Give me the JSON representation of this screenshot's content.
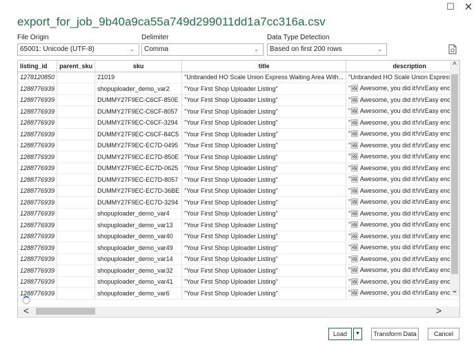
{
  "window": {
    "maximize_glyph": "☐",
    "close_glyph": "✕",
    "title": "export_for_job_9b40a9ca55a749d299011dd1a7cc316a.csv"
  },
  "settings": {
    "file_origin_label": "File Origin",
    "file_origin_value": "65001: Unicode (UTF-8)",
    "delimiter_label": "Delimiter",
    "delimiter_value": "Comma",
    "detection_label": "Data Type Detection",
    "detection_value": "Based on first 200 rows",
    "chevron": "⌄"
  },
  "table": {
    "columns": [
      "listing_id",
      "parent_sku",
      "sku",
      "title",
      "description"
    ],
    "rows": [
      [
        "1278120850",
        "",
        "21019",
        "\"Unbranded HO Scale Union Express Waiting Area With...",
        "\"Unbranded HO Scale Union Express Waitin"
      ],
      [
        "1288776939",
        "",
        "shopuploader_demo_var2",
        "\"Your First Shop Uploader Listing\"",
        "\"🖼 Awesome, you did it!\\r\\rEasy enough,"
      ],
      [
        "1288776939",
        "",
        "DUMMY27F9EC-C6CF-850E",
        "\"Your First Shop Uploader Listing\"",
        "\"🖼 Awesome, you did it!\\r\\rEasy enough,"
      ],
      [
        "1288776939",
        "",
        "DUMMY27F9EC-C6CF-8057",
        "\"Your First Shop Uploader Listing\"",
        "\"🖼 Awesome, you did it!\\r\\rEasy enough,"
      ],
      [
        "1288776939",
        "",
        "DUMMY27F9EC-C6CF-3294",
        "\"Your First Shop Uploader Listing\"",
        "\"🖼 Awesome, you did it!\\r\\rEasy enough,"
      ],
      [
        "1288776939",
        "",
        "DUMMY27F9EC-C6CF-84C5",
        "\"Your First Shop Uploader Listing\"",
        "\"🖼 Awesome, you did it!\\r\\rEasy enough,"
      ],
      [
        "1288776939",
        "",
        "DUMMY27F9EC-EC7D-0495",
        "\"Your First Shop Uploader Listing\"",
        "\"🖼 Awesome, you did it!\\r\\rEasy enough,"
      ],
      [
        "1288776939",
        "",
        "DUMMY27F9EC-EC7D-850E",
        "\"Your First Shop Uploader Listing\"",
        "\"🖼 Awesome, you did it!\\r\\rEasy enough,"
      ],
      [
        "1288776939",
        "",
        "DUMMY27F9EC-EC7D-0625",
        "\"Your First Shop Uploader Listing\"",
        "\"🖼 Awesome, you did it!\\r\\rEasy enough,"
      ],
      [
        "1288776939",
        "",
        "DUMMY27F9EC-EC7D-8057",
        "\"Your First Shop Uploader Listing\"",
        "\"🖼 Awesome, you did it!\\r\\rEasy enough,"
      ],
      [
        "1288776939",
        "",
        "DUMMY27F9EC-EC7D-36BE",
        "\"Your First Shop Uploader Listing\"",
        "\"🖼 Awesome, you did it!\\r\\rEasy enough,"
      ],
      [
        "1288776939",
        "",
        "DUMMY27F9EC-EC7D-3294",
        "\"Your First Shop Uploader Listing\"",
        "\"🖼 Awesome, you did it!\\r\\rEasy enough,"
      ],
      [
        "1288776939",
        "",
        "shopuploader_demo_var4",
        "\"Your First Shop Uploader Listing\"",
        "\"🖼 Awesome, you did it!\\r\\rEasy enough,"
      ],
      [
        "1288776939",
        "",
        "shopuploader_demo_var13",
        "\"Your First Shop Uploader Listing\"",
        "\"🖼 Awesome, you did it!\\r\\rEasy enough,"
      ],
      [
        "1288776939",
        "",
        "shopuploader_demo_var40",
        "\"Your First Shop Uploader Listing\"",
        "\"🖼 Awesome, you did it!\\r\\rEasy enough,"
      ],
      [
        "1288776939",
        "",
        "shopuploader_demo_var49",
        "\"Your First Shop Uploader Listing\"",
        "\"🖼 Awesome, you did it!\\r\\rEasy enough,"
      ],
      [
        "1288776939",
        "",
        "shopuploader_demo_var14",
        "\"Your First Shop Uploader Listing\"",
        "\"🖼 Awesome, you did it!\\r\\rEasy enough,"
      ],
      [
        "1288776939",
        "",
        "shopuploader_demo_var32",
        "\"Your First Shop Uploader Listing\"",
        "\"🖼 Awesome, you did it!\\r\\rEasy enough,"
      ],
      [
        "1288776939",
        "",
        "shopuploader_demo_var41",
        "\"Your First Shop Uploader Listing\"",
        "\"🖼 Awesome, you did it!\\r\\rEasy enough,"
      ],
      [
        "1288776939",
        "",
        "shopuploader_demo_var6",
        "\"Your First Shop Uploader Listing\"",
        "\"🖼 Awesome, you did it!\\r\\rEasy enough,"
      ]
    ]
  },
  "scroll": {
    "up_arrow": "^",
    "down_arrow": "⌄",
    "left_arrow": "<",
    "right_arrow": ">"
  },
  "footer": {
    "load_label": "Load",
    "load_dropdown": "▼",
    "transform_label": "Transform Data",
    "cancel_label": "Cancel"
  },
  "colors": {
    "title": "#217346",
    "accent": "#217346"
  }
}
